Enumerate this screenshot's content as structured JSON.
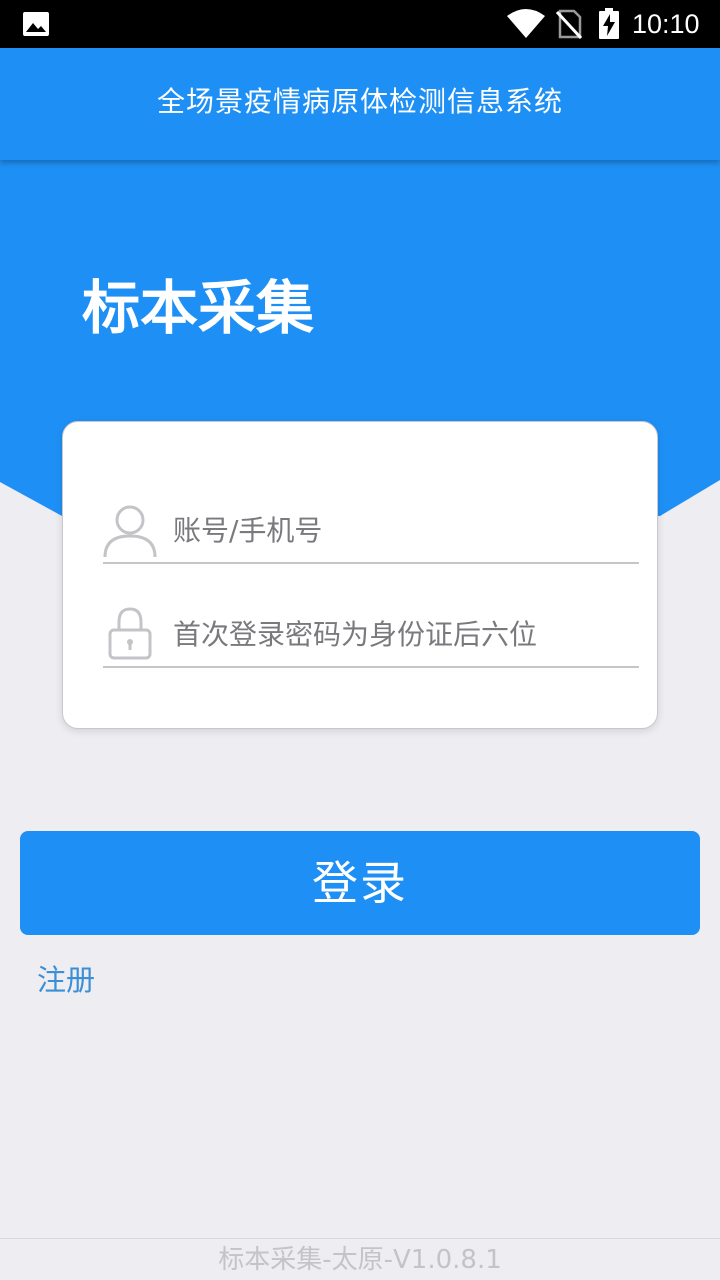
{
  "status_bar": {
    "time": "10:10",
    "icons": [
      "gallery-icon",
      "wifi-icon",
      "no-signal-icon",
      "battery-charging-icon"
    ]
  },
  "app_bar": {
    "title": "全场景疫情病原体检测信息系统"
  },
  "hero": {
    "title": "标本采集"
  },
  "login_form": {
    "account": {
      "placeholder": "账号/手机号",
      "value": "",
      "icon": "user-icon"
    },
    "password": {
      "placeholder": "首次登录密码为身份证后六位",
      "value": "",
      "icon": "lock-icon"
    },
    "submit_label": "登录"
  },
  "register_label": "注册",
  "footer": {
    "version": "标本采集-太原-V1.0.8.1"
  },
  "colors": {
    "primary": "#1e90f5",
    "background": "#eeedf2",
    "link": "#3a8fd6"
  }
}
